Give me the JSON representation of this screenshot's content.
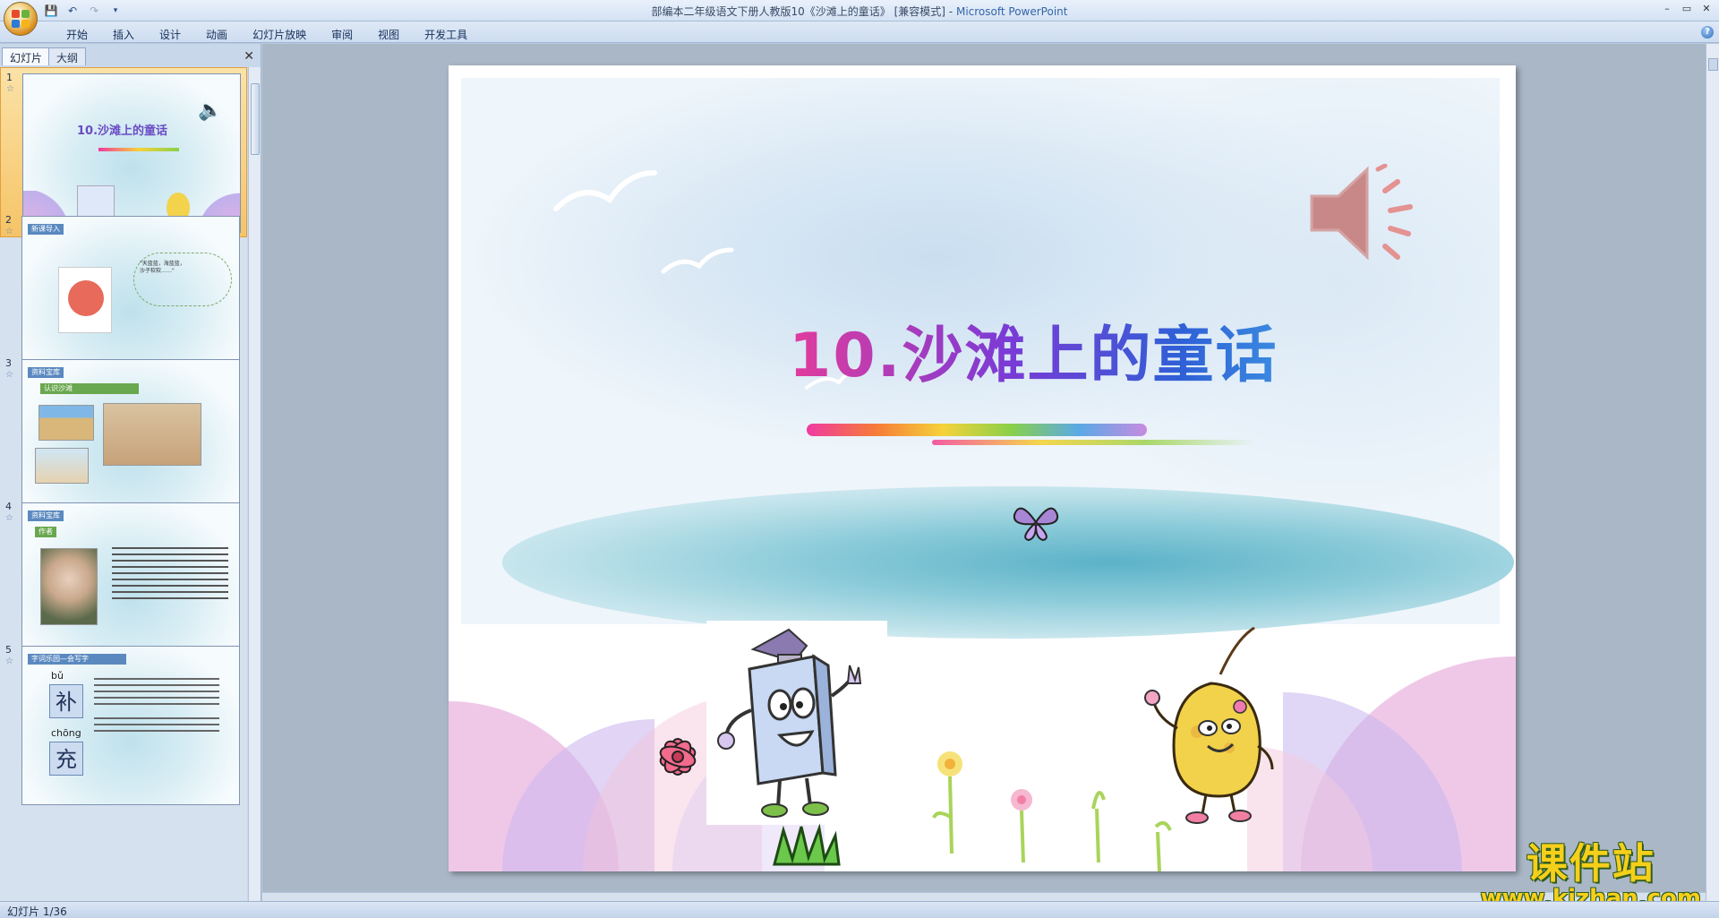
{
  "window": {
    "title": "部编本二年级语文下册人教版10《沙滩上的童话》 [兼容模式] -",
    "app_name": "Microsoft PowerPoint",
    "controls": [
      "–",
      "▭",
      "✕"
    ]
  },
  "ribbon": {
    "tabs": [
      "开始",
      "插入",
      "设计",
      "动画",
      "幻灯片放映",
      "审阅",
      "视图",
      "开发工具"
    ],
    "help": "?"
  },
  "left_pane": {
    "tabs": [
      "幻灯片",
      "大纲"
    ],
    "close": "✕",
    "thumbnails": [
      {
        "number": "1",
        "title": "10.沙滩上的童话",
        "selected": true
      },
      {
        "number": "2",
        "heading": "新课导入",
        "text": "\"天蓝蓝，海蓝蓝，\n沙子软软……\""
      },
      {
        "number": "3",
        "heading": "资料宝库",
        "subheading": "认识沙滩"
      },
      {
        "number": "4",
        "heading": "资料宝库",
        "subheading": "作者"
      },
      {
        "number": "5",
        "heading": "字词乐园—会写字",
        "char1": "补",
        "pinyin1": "bǔ",
        "char2": "充",
        "pinyin2": "chōng"
      }
    ]
  },
  "slide": {
    "title": "10.沙滩上的童话"
  },
  "status": {
    "slide_indicator": "幻灯片 1/36"
  },
  "watermark": {
    "cn": "课件站",
    "en": "www.kjzhan.com"
  },
  "colors": {
    "accent": "#2f5fd6",
    "selected_thumb": "#f6c467",
    "watermark": "#f5cf1a"
  }
}
